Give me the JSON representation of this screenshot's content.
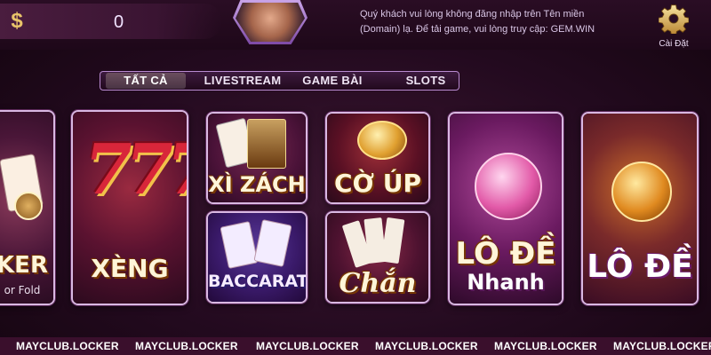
{
  "header": {
    "coin_value": "0",
    "notice_text": "Quý khách vui lòng không đăng nhập trên Tên miền (Domain) lạ. Để tải game, vui lòng truy cập: GEM.WIN",
    "settings_label": "Cài Đặt"
  },
  "tabs": [
    {
      "label": "TẤT CẢ",
      "active": true
    },
    {
      "label": "LIVESTREAM",
      "active": false
    },
    {
      "label": "GAME BÀI",
      "active": false
    },
    {
      "label": "SLOTS",
      "active": false
    }
  ],
  "games": {
    "poker": {
      "title": "KER",
      "subtitle": "or Fold"
    },
    "xeng": {
      "title": "XÈNG"
    },
    "xizach": {
      "title": "XÌ ZÁCH"
    },
    "baccarat": {
      "title": "BACCARAT"
    },
    "coup": {
      "title": "CỜ ÚP"
    },
    "chan": {
      "title": "Chắn"
    },
    "lode_nhanh": {
      "title": "LÔ ĐỀ",
      "subtitle": "Nhanh"
    },
    "lode": {
      "title": "LÔ ĐỀ"
    }
  },
  "watermark": "MAYCLUB.LOCKER",
  "colors": {
    "background": "#230a1f",
    "card_border": "#d9b8e2",
    "gold": "#e9c46a",
    "watermark_bar": "#3a0f2c"
  }
}
